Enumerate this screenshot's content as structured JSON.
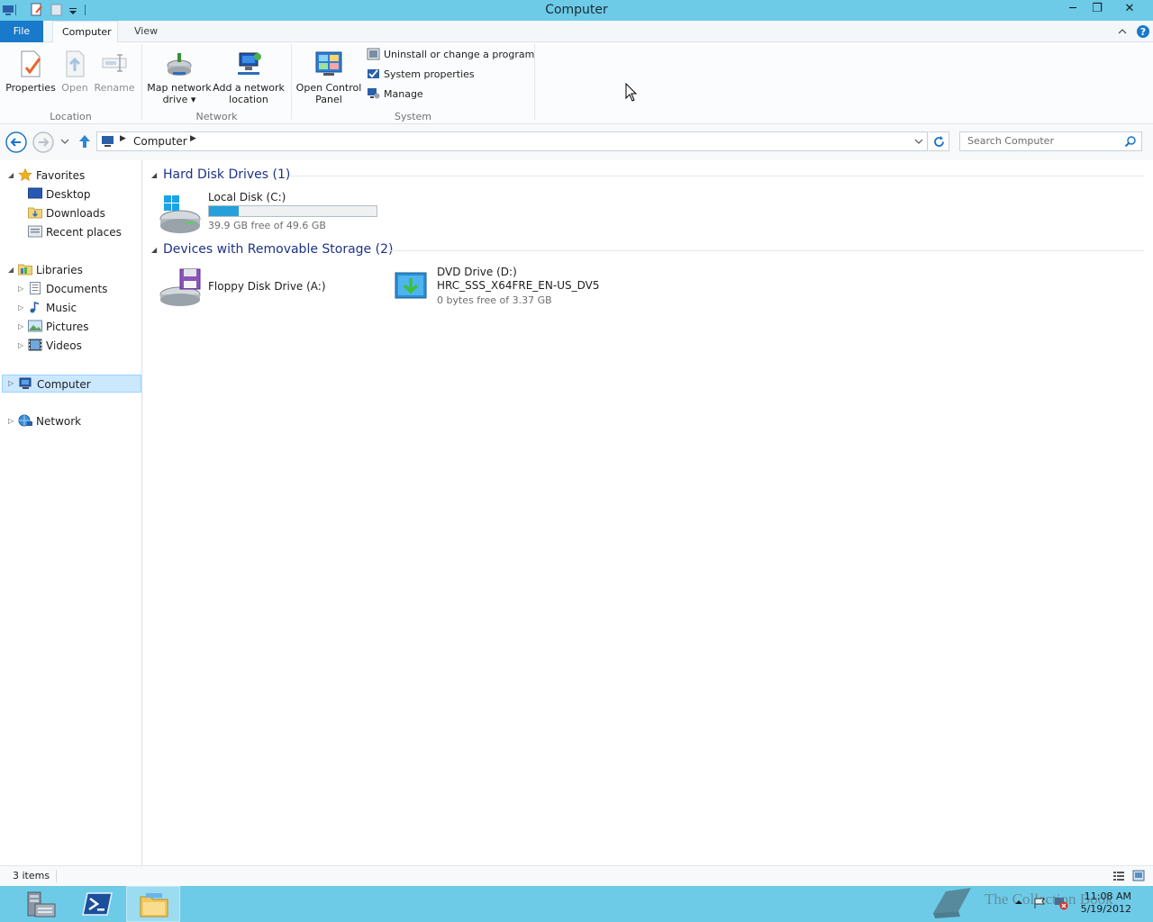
{
  "window": {
    "title": "Computer",
    "minimize_label": "─",
    "restore_label": "❐",
    "close_label": "✕"
  },
  "ribbon": {
    "tabs": [
      {
        "label": "File"
      },
      {
        "label": "Computer"
      },
      {
        "label": "View"
      }
    ],
    "location": {
      "group_label": "Location",
      "properties_label": "Properties",
      "open_label": "Open",
      "rename_label": "Rename"
    },
    "network": {
      "group_label": "Network",
      "map_drive_line1": "Map network",
      "map_drive_line2": "drive ▾",
      "add_location_line1": "Add a network",
      "add_location_line2": "location"
    },
    "system": {
      "group_label": "System",
      "control_panel_line1": "Open Control",
      "control_panel_line2": "Panel",
      "uninstall_label": "Uninstall or change a program",
      "system_properties_label": "System properties",
      "manage_label": "Manage"
    }
  },
  "address": {
    "path": [
      {
        "label": "Computer"
      }
    ]
  },
  "search": {
    "placeholder": "Search Computer"
  },
  "nav": {
    "favorites": {
      "label": "Favorites",
      "items": [
        {
          "label": "Desktop"
        },
        {
          "label": "Downloads"
        },
        {
          "label": "Recent places"
        }
      ]
    },
    "libraries": {
      "label": "Libraries",
      "items": [
        {
          "label": "Documents"
        },
        {
          "label": "Music"
        },
        {
          "label": "Pictures"
        },
        {
          "label": "Videos"
        }
      ]
    },
    "computer": {
      "label": "Computer"
    },
    "network": {
      "label": "Network"
    }
  },
  "groups": [
    {
      "title": "Hard Disk Drives (1)",
      "drives": [
        {
          "name": "Local Disk (C:)",
          "free_text": "39.9 GB free of 49.6 GB",
          "used_fraction": 0.18
        }
      ]
    },
    {
      "title": "Devices with Removable Storage (2)",
      "drives": [
        {
          "name": "Floppy Disk Drive (A:)"
        },
        {
          "name": "DVD Drive (D:)",
          "volume_label": "HRC_SSS_X64FRE_EN-US_DV5",
          "free_text": "0 bytes free of 3.37 GB"
        }
      ]
    }
  ],
  "status": {
    "items_text": "3 items"
  },
  "taskbar": {
    "time": "11:08 AM",
    "date": "5/19/2012",
    "watermark_text": "The Collection Book"
  },
  "colors": {
    "titlebar": "#6dcbe8",
    "file_tab": "#1979ca",
    "group_heading": "#1e3287",
    "progress_fill": "#26a0da",
    "selection": "#cce8ff"
  }
}
